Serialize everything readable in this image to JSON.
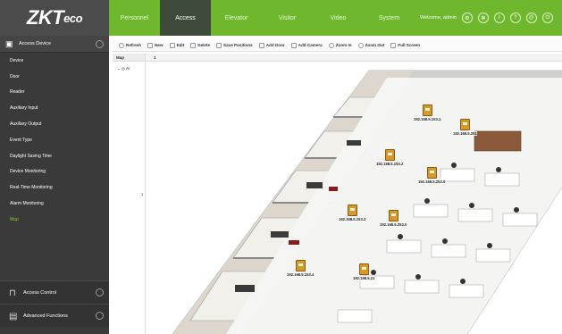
{
  "logo": {
    "main": "ZKT",
    "sub": "eco"
  },
  "nav": {
    "tabs": [
      {
        "label": "Personnel"
      },
      {
        "label": "Access"
      },
      {
        "label": "Elevator"
      },
      {
        "label": "Visitor"
      },
      {
        "label": "Video"
      },
      {
        "label": "System"
      }
    ],
    "active": "Access",
    "welcome": "Welcome, admin"
  },
  "sidebar": {
    "section_title": "Access Device",
    "items": [
      {
        "label": "Device"
      },
      {
        "label": "Door"
      },
      {
        "label": "Reader"
      },
      {
        "label": "Auxiliary Input"
      },
      {
        "label": "Auxiliary Output"
      },
      {
        "label": "Event Type"
      },
      {
        "label": "Daylight Saving Time"
      },
      {
        "label": "Device Monitoring"
      },
      {
        "label": "Real-Time Monitoring"
      },
      {
        "label": "Alarm Monitoring"
      },
      {
        "label": "Map"
      }
    ],
    "footer": [
      {
        "label": "Access Control"
      },
      {
        "label": "Advanced Functions"
      }
    ]
  },
  "toolbar": {
    "buttons": [
      {
        "label": "Refresh"
      },
      {
        "label": "New"
      },
      {
        "label": "Edit"
      },
      {
        "label": "Delete"
      },
      {
        "label": "Save Positions"
      },
      {
        "label": "Add Door"
      },
      {
        "label": "Add Camera"
      },
      {
        "label": "Zoom In"
      },
      {
        "label": "Zoom Out"
      },
      {
        "label": "Full Screen"
      }
    ]
  },
  "tree": {
    "header": "Map",
    "node": "Ar",
    "splitter": "1"
  },
  "map_tab": {
    "label": "1"
  },
  "cameras": [
    {
      "label": "192.168.5.153.1"
    },
    {
      "label": "192.168.5.251"
    },
    {
      "label": "192.168.5.153.2"
    },
    {
      "label": "192.168.5.153.3"
    },
    {
      "label": "192.168.5.253.0"
    },
    {
      "label": "192.168.5.153.4"
    },
    {
      "label": "192.168.5.21"
    }
  ],
  "colors": {
    "accent": "#6fb82e",
    "sidebar": "#3a3a3a",
    "active_item": "#7fc93a"
  }
}
